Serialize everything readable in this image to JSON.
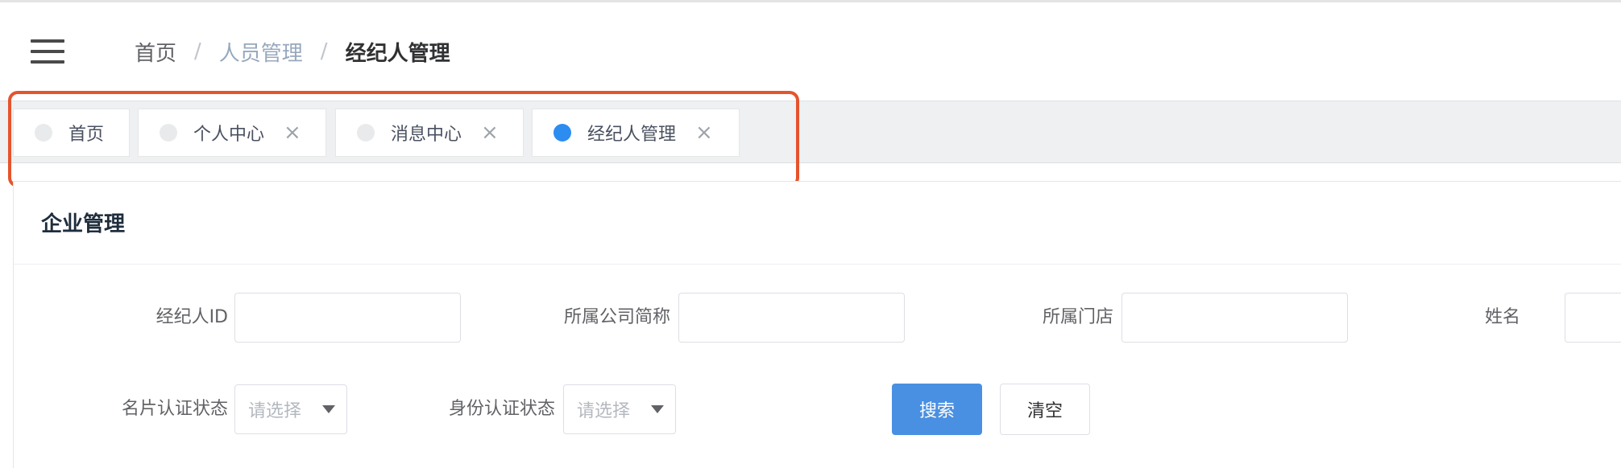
{
  "breadcrumb": {
    "items": [
      {
        "label": "首页"
      },
      {
        "label": "人员管理"
      },
      {
        "label": "经纪人管理"
      }
    ],
    "separator": "/"
  },
  "tags": [
    {
      "label": "首页",
      "active": false,
      "closable": false
    },
    {
      "label": "个人中心",
      "active": false,
      "closable": true
    },
    {
      "label": "消息中心",
      "active": false,
      "closable": true
    },
    {
      "label": "经纪人管理",
      "active": true,
      "closable": true
    }
  ],
  "tag_close_glyph": "×",
  "colors": {
    "active_dot": "#2d8cf0",
    "inactive_dot": "#e8eaec",
    "highlight_border": "#e5542d",
    "primary_button": "#4a90e2"
  },
  "card": {
    "title": "企业管理"
  },
  "filters": {
    "agent_id": {
      "label": "经纪人ID",
      "value": ""
    },
    "company_short_name": {
      "label": "所属公司简称",
      "value": ""
    },
    "store": {
      "label": "所属门店",
      "value": ""
    },
    "name": {
      "label": "姓名",
      "value": ""
    },
    "card_auth_status": {
      "label": "名片认证状态",
      "placeholder": "请选择"
    },
    "identity_auth_status": {
      "label": "身份认证状态",
      "placeholder": "请选择"
    }
  },
  "buttons": {
    "search": "搜索",
    "clear": "清空"
  }
}
